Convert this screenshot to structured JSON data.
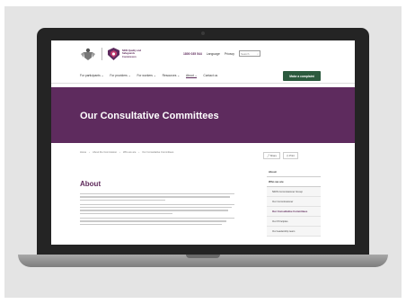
{
  "colors": {
    "brand_purple": "#5e2b5e",
    "button_green": "#2c5a3e"
  },
  "header": {
    "commission_name": "NDIS Quality and Safeguards Commission",
    "phone": "1800 035 544",
    "language": "Language",
    "privacy": "Privacy",
    "search_placeholder": "Search",
    "search_icon": "search-icon"
  },
  "nav": {
    "items": [
      "For participants ⌄",
      "For providers ⌄",
      "For workers ⌄",
      "Resources ⌄",
      "About ⌄",
      "Contact us"
    ],
    "complaint_button": "Make a complaint"
  },
  "hero": {
    "title": "Our Consultative Committees"
  },
  "breadcrumb": [
    "Home",
    "About the Commission",
    "Who we are",
    "Our Consultative Committees"
  ],
  "share": {
    "share": "Share",
    "print": "Print"
  },
  "main": {
    "heading": "About"
  },
  "sidebar": {
    "section": "About",
    "subsection": "Who we are",
    "items": [
      "NDIS Commissioner Group",
      "Our Commissioner",
      "Our Consultative Committees",
      "Our Principles",
      "Our leadership team"
    ]
  }
}
